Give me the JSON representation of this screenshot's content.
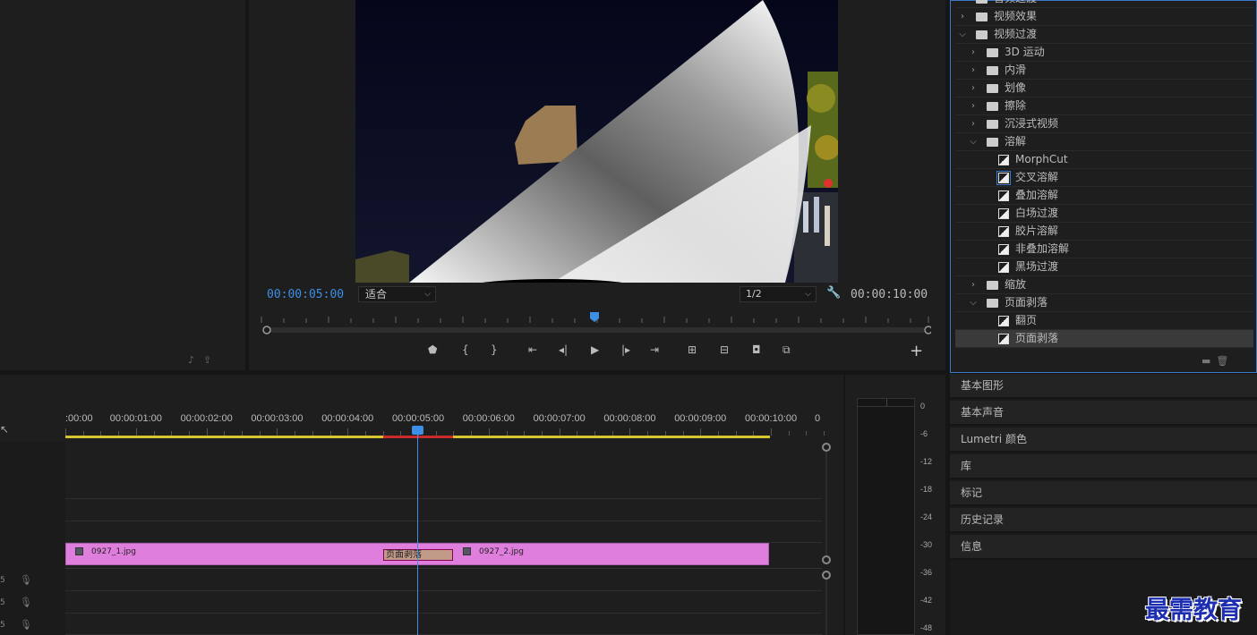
{
  "program": {
    "timecode_current": "00:00:05:00",
    "timecode_duration": "00:00:10:00",
    "fit": "适合",
    "resolution": "1/2"
  },
  "effects": {
    "items": [
      {
        "label": "音频过渡",
        "level": 0,
        "type": "folder",
        "state": "collapsed"
      },
      {
        "label": "视频效果",
        "level": 0,
        "type": "folder",
        "state": "collapsed"
      },
      {
        "label": "视频过渡",
        "level": 0,
        "type": "folder",
        "state": "expanded"
      },
      {
        "label": "3D 运动",
        "level": 1,
        "type": "folder",
        "state": "collapsed"
      },
      {
        "label": "内滑",
        "level": 1,
        "type": "folder",
        "state": "collapsed"
      },
      {
        "label": "划像",
        "level": 1,
        "type": "folder",
        "state": "collapsed"
      },
      {
        "label": "擦除",
        "level": 1,
        "type": "folder",
        "state": "collapsed"
      },
      {
        "label": "沉浸式视频",
        "level": 1,
        "type": "folder",
        "state": "collapsed"
      },
      {
        "label": "溶解",
        "level": 1,
        "type": "folder",
        "state": "expanded"
      },
      {
        "label": "MorphCut",
        "level": 2,
        "type": "effect"
      },
      {
        "label": "交叉溶解",
        "level": 2,
        "type": "effect",
        "highlight": true
      },
      {
        "label": "叠加溶解",
        "level": 2,
        "type": "effect"
      },
      {
        "label": "白场过渡",
        "level": 2,
        "type": "effect"
      },
      {
        "label": "胶片溶解",
        "level": 2,
        "type": "effect"
      },
      {
        "label": "非叠加溶解",
        "level": 2,
        "type": "effect"
      },
      {
        "label": "黑场过渡",
        "level": 2,
        "type": "effect"
      },
      {
        "label": "缩放",
        "level": 1,
        "type": "folder",
        "state": "collapsed"
      },
      {
        "label": "页面剥落",
        "level": 1,
        "type": "folder",
        "state": "expanded"
      },
      {
        "label": "翻页",
        "level": 2,
        "type": "effect"
      },
      {
        "label": "页面剥落",
        "level": 2,
        "type": "effect",
        "selected": true
      }
    ]
  },
  "panels": [
    "基本图形",
    "基本声音",
    "Lumetri 颜色",
    "库",
    "标记",
    "历史记录",
    "信息"
  ],
  "timeline": {
    "ruler_labels": [
      ":00:00",
      "00:00:01:00",
      "00:00:02:00",
      "00:00:03:00",
      "00:00:04:00",
      "00:00:05:00",
      "00:00:06:00",
      "00:00:07:00",
      "00:00:08:00",
      "00:00:09:00",
      "00:00:10:00",
      "0"
    ],
    "clip1_name": "0927_1.jpg",
    "clip2_name": "0927_2.jpg",
    "transition_name": "页面剥落",
    "track_labels": [
      "5",
      "5",
      "5"
    ],
    "clip_color": "#e07edd",
    "playhead_color": "#3d8fe5"
  },
  "meter": {
    "db_labels": [
      "0",
      "-6",
      "-12",
      "-18",
      "-24",
      "-30",
      "-36",
      "-42",
      "-48"
    ]
  },
  "watermark": "最需教育"
}
